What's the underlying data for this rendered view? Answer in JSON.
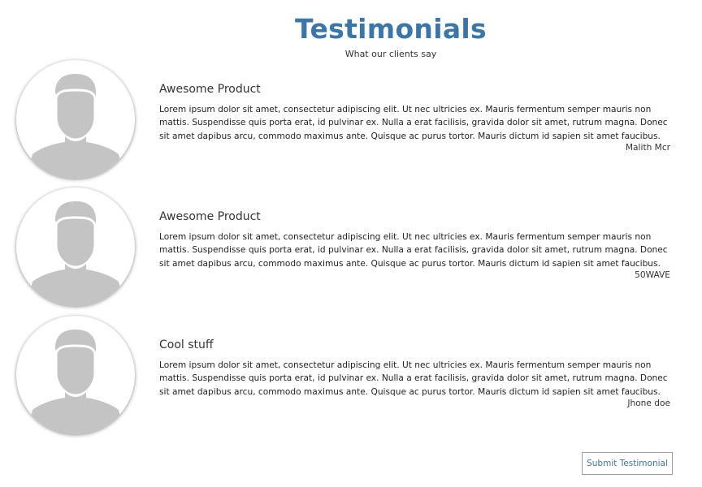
{
  "header": {
    "title": "Testimonials",
    "subtitle": "What our clients say"
  },
  "testimonials": [
    {
      "title": "Awesome Product",
      "body": "Lorem ipsum dolor sit amet, consectetur adipiscing elit. Ut nec ultricies ex. Mauris fermentum semper mauris non mattis. Suspendisse quis porta erat, id pulvinar ex. Nulla a erat facilisis, gravida dolor sit amet, rutrum magna. Donec sit amet dapibus arcu, commodo maximus ante. Quisque ac purus tortor. Mauris dictum id sapien sit amet faucibus.",
      "author": "Malith Mcr",
      "avatar_icon": "user-avatar-icon"
    },
    {
      "title": "Awesome Product",
      "body": "Lorem ipsum dolor sit amet, consectetur adipiscing elit. Ut nec ultricies ex. Mauris fermentum semper mauris non mattis. Suspendisse quis porta erat, id pulvinar ex. Nulla a erat facilisis, gravida dolor sit amet, rutrum magna. Donec sit amet dapibus arcu, commodo maximus ante. Quisque ac purus tortor. Mauris dictum id sapien sit amet faucibus.",
      "author": "50WAVE",
      "avatar_icon": "user-avatar-icon"
    },
    {
      "title": "Cool stuff",
      "body": "Lorem ipsum dolor sit amet, consectetur adipiscing elit. Ut nec ultricies ex. Mauris fermentum semper mauris non mattis. Suspendisse quis porta erat, id pulvinar ex. Nulla a erat facilisis, gravida dolor sit amet, rutrum magna. Donec sit amet dapibus arcu, commodo maximus ante. Quisque ac purus tortor. Mauris dictum id sapien sit amet faucibus.",
      "author": "Jhone doe",
      "avatar_icon": "user-avatar-icon"
    }
  ],
  "actions": {
    "submit_label": "Submit Testimonial"
  },
  "colors": {
    "accent": "#3a76a8",
    "avatar_gray": "#c4c4c4",
    "text": "#222222"
  }
}
